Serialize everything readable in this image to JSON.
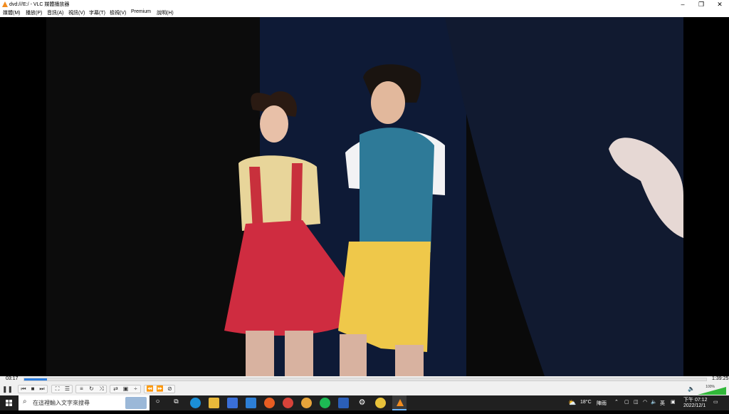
{
  "window": {
    "title": "dvd:///E:/ - VLC 媒體播放器"
  },
  "menu": {
    "items": [
      "媒體(M)",
      "播放(P)",
      "音訊(A)",
      "視訊(V)",
      "字幕(T)",
      "檢視(V)",
      "Premium",
      "說明(H)"
    ]
  },
  "player": {
    "elapsed": "03:17",
    "duration": "1:39:25",
    "progress": 0.033,
    "volume_label": "100%",
    "volume_level": 1.0
  },
  "taskbar": {
    "search_placeholder": "在這裡輸入文字來搜尋",
    "weather_temp": "18°C",
    "weather_desc": "陣雨",
    "ime": "英",
    "time": "下午 07:12",
    "date": "2022/12/1"
  },
  "colors": {
    "accent": "#2a7de1",
    "vlc_orange": "#f28c1e",
    "taskbar": "#202020"
  },
  "icons": {
    "controls": [
      "pause-icon",
      "prev-icon",
      "stop-icon",
      "next-icon",
      "fullscreen-icon",
      "extended-settings-icon",
      "playlist-icon",
      "loop-icon",
      "random-icon",
      "ab-loop-icon",
      "snapshot-icon",
      "frame-step-icon",
      "prev-chapter-icon",
      "next-chapter-icon",
      "disc-menu-icon"
    ],
    "taskbar": [
      "cortana-icon",
      "task-view-icon",
      "edge-icon",
      "file-explorer-icon",
      "store-icon",
      "mail-icon",
      "firefox-icon",
      "chrome-icon",
      "chrome-alt-icon",
      "spotify-icon",
      "word-icon",
      "settings-icon",
      "app-icon",
      "vlc-icon"
    ]
  }
}
